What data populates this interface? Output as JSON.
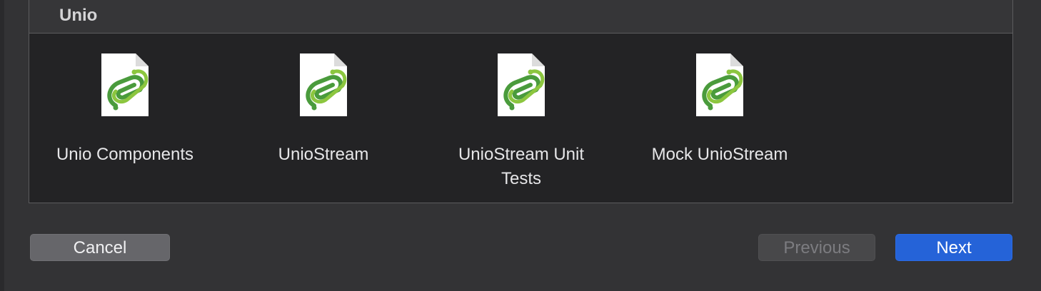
{
  "section": {
    "title": "Unio"
  },
  "templates": [
    {
      "label": "Unio Components",
      "icon": "paperclip-document-icon"
    },
    {
      "label": "UnioStream",
      "icon": "paperclip-document-icon"
    },
    {
      "label": "UnioStream Unit Tests",
      "icon": "paperclip-document-icon"
    },
    {
      "label": "Mock UnioStream",
      "icon": "paperclip-document-icon"
    }
  ],
  "buttons": {
    "cancel": "Cancel",
    "previous": "Previous",
    "next": "Next"
  },
  "colors": {
    "accent": "#2563d8",
    "icon_green_dark": "#4a9b3c",
    "icon_green_light": "#8cc63f"
  }
}
